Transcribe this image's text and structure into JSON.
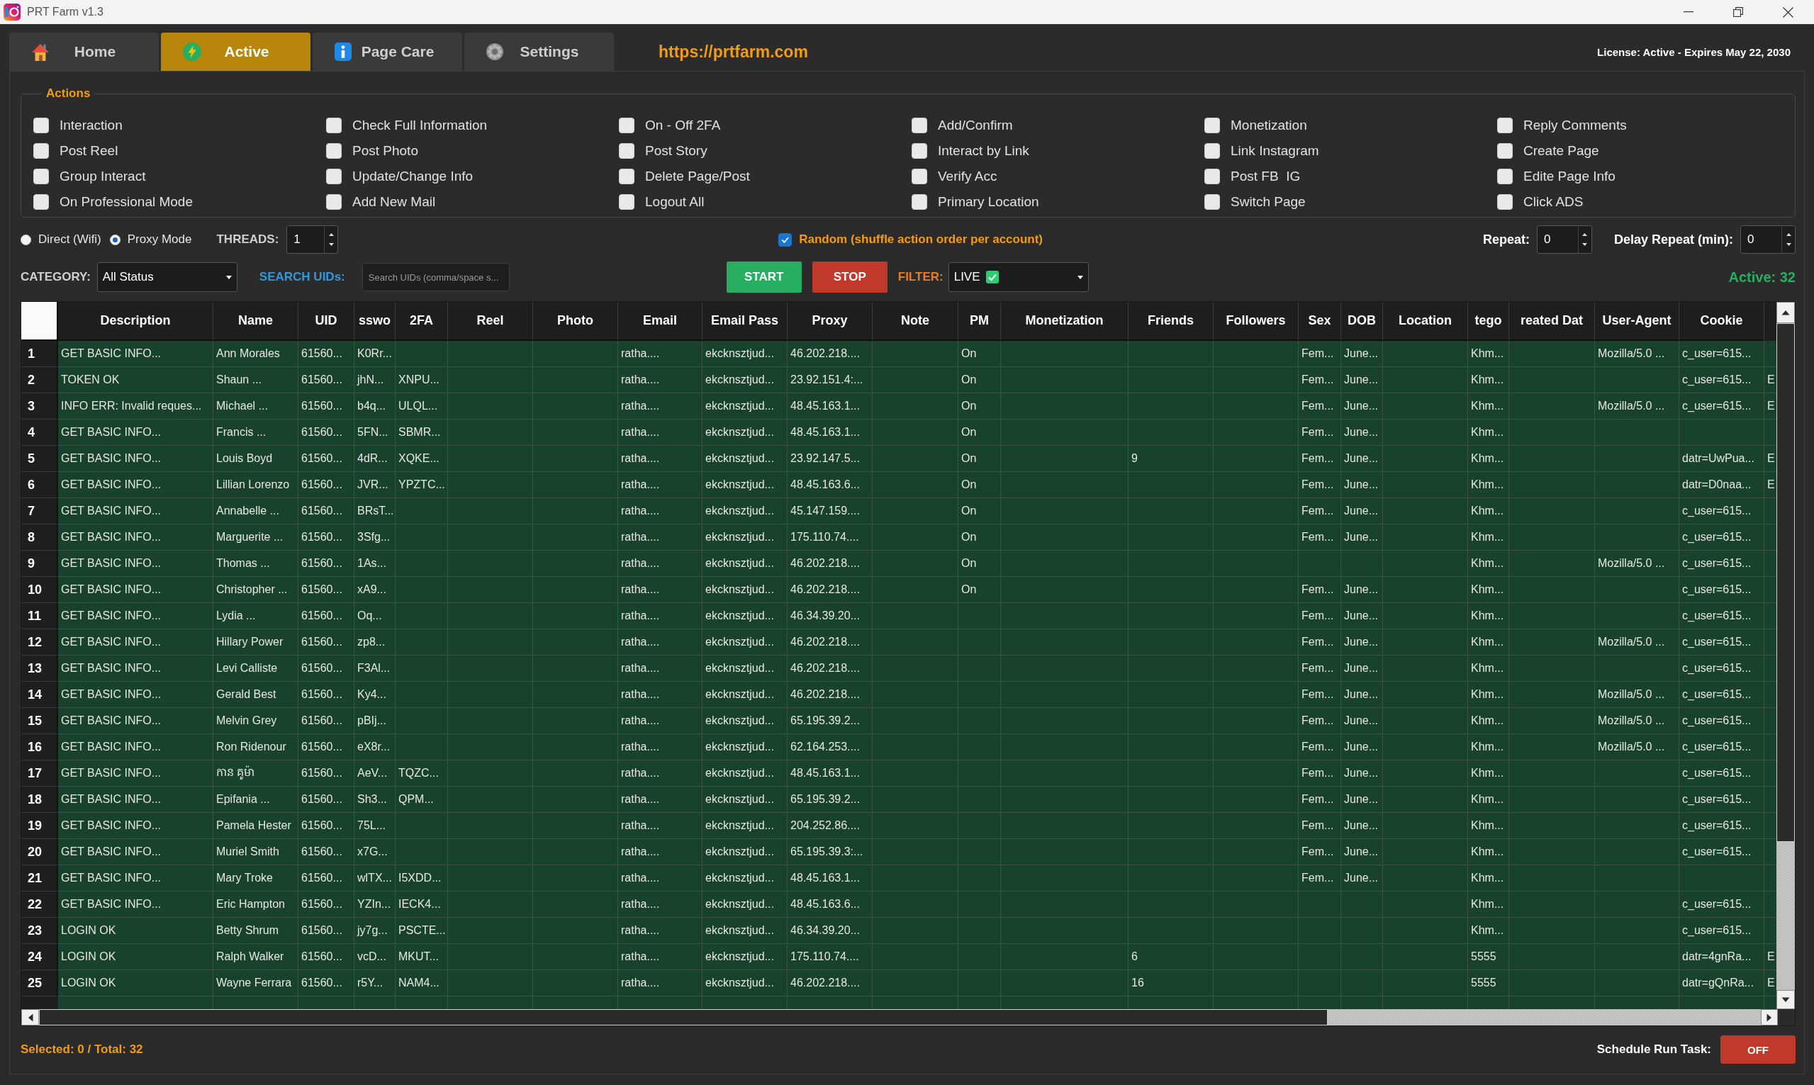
{
  "window": {
    "title": "PRT Farm v1.3"
  },
  "tabs": [
    {
      "label": "Home",
      "selected": false
    },
    {
      "label": "Active",
      "selected": true
    },
    {
      "label": "Page Care",
      "selected": false
    },
    {
      "label": "Settings",
      "selected": false
    }
  ],
  "website_link": "https://prtfarm.com",
  "license": "License: Active - Expires May 22, 2030",
  "actions": {
    "title": "Actions",
    "options": [
      {
        "label": "Interaction",
        "checked": false
      },
      {
        "label": "Check Full Information",
        "checked": false
      },
      {
        "label": "On - Off 2FA",
        "checked": false
      },
      {
        "label": "Add/Confirm",
        "checked": false
      },
      {
        "label": "Monetization",
        "checked": false
      },
      {
        "label": "Reply Comments",
        "checked": false
      },
      {
        "label": "Post Reel",
        "checked": false
      },
      {
        "label": "Post Photo",
        "checked": false
      },
      {
        "label": "Post Story",
        "checked": false
      },
      {
        "label": "Interact by Link",
        "checked": false
      },
      {
        "label": "Link Instagram",
        "checked": false
      },
      {
        "label": "Create Page",
        "checked": false
      },
      {
        "label": "Group Interact",
        "checked": false
      },
      {
        "label": "Update/Change Info",
        "checked": false
      },
      {
        "label": "Delete Page/Post",
        "checked": false
      },
      {
        "label": "Verify Acc",
        "checked": false
      },
      {
        "label": "Post FB  IG",
        "checked": false
      },
      {
        "label": "Edite Page Info",
        "checked": false
      },
      {
        "label": "On Professional Mode",
        "checked": false
      },
      {
        "label": "Add New Mail",
        "checked": false
      },
      {
        "label": "Logout All",
        "checked": false
      },
      {
        "label": "Primary Location",
        "checked": false
      },
      {
        "label": "Switch Page",
        "checked": false
      },
      {
        "label": "Click ADS",
        "checked": false
      }
    ]
  },
  "connection": {
    "options": [
      {
        "label": "Direct (Wifi)",
        "selected": false
      },
      {
        "label": "Proxy Mode",
        "selected": true
      }
    ]
  },
  "threads": {
    "label": "THREADS:",
    "value": "1"
  },
  "random_order": {
    "label": "Random (shuffle action order per account)",
    "checked": true
  },
  "repeat": {
    "label": "Repeat:",
    "value": "0"
  },
  "delay_repeat": {
    "label": "Delay Repeat (min):",
    "value": "0"
  },
  "category": {
    "label": "CATEGORY:",
    "value": "All Status"
  },
  "search_uids": {
    "label": "SEARCH UIDs:",
    "placeholder": "Search UIDs (comma/space s..."
  },
  "buttons": [
    {
      "label": "START",
      "kind": "start"
    },
    {
      "label": "STOP",
      "kind": "stop"
    }
  ],
  "filter": {
    "label": "FILTER:",
    "value": "LIVE"
  },
  "active_count": "Active: 32",
  "table": {
    "columns": [
      "Description",
      "Name",
      "UID",
      "sswo",
      "2FA",
      "Reel",
      "Photo",
      "Email",
      "Email Pass",
      "Proxy",
      "Note",
      "PM",
      "Monetization",
      "Friends",
      "Followers",
      "Sex",
      "DOB",
      "Location",
      "tego",
      "reated Dat",
      "User-Agent",
      "Cookie"
    ],
    "rows": [
      {
        "number": "1",
        "description": "GET BASIC INFO...",
        "name": "Ann Morales",
        "uid": "61560...",
        "column_4": "K0Rr...",
        "email": "ratha....",
        "email_pass": "ekcknsztjud...",
        "proxy": "46.202.218....",
        "pm": "On",
        "sex": "Fem...",
        "dob": "June...",
        "column_19": "Khm...",
        "user_agent": "Mozilla/5.0 ...",
        "cookie": "c_user=615..."
      },
      {
        "number": "2",
        "description": "TOKEN OK",
        "name": "Shaun ...",
        "uid": "61560...",
        "column_4": "jhN...",
        "two_fa": "XNPU...",
        "email": "ratha....",
        "email_pass": "ekcknsztjud...",
        "proxy": "23.92.151.4:...",
        "pm": "On",
        "sex": "Fem...",
        "dob": "June...",
        "column_19": "Khm...",
        "cookie": "c_user=615...",
        "column_23": "E"
      },
      {
        "number": "3",
        "description": "INFO ERR: Invalid reques...",
        "name": "Michael ...",
        "uid": "61560...",
        "column_4": "b4q...",
        "two_fa": "ULQL...",
        "email": "ratha....",
        "email_pass": "ekcknsztjud...",
        "proxy": "48.45.163.1...",
        "pm": "On",
        "sex": "Fem...",
        "dob": "June...",
        "column_19": "Khm...",
        "user_agent": "Mozilla/5.0 ...",
        "cookie": "c_user=615...",
        "column_23": "E"
      },
      {
        "number": "4",
        "description": "GET BASIC INFO...",
        "name": "Francis ...",
        "uid": "61560...",
        "column_4": "5FN...",
        "two_fa": "SBMR...",
        "email": "ratha....",
        "email_pass": "ekcknsztjud...",
        "proxy": "48.45.163.1...",
        "pm": "On",
        "sex": "Fem...",
        "dob": "June...",
        "column_19": "Khm..."
      },
      {
        "number": "5",
        "description": "GET BASIC INFO...",
        "name": "Louis Boyd",
        "uid": "61560...",
        "column_4": "4dR...",
        "two_fa": "XQKE...",
        "email": "ratha....",
        "email_pass": "ekcknsztjud...",
        "proxy": "23.92.147.5...",
        "pm": "On",
        "friends": "9",
        "sex": "Fem...",
        "dob": "June...",
        "column_19": "Khm...",
        "cookie": "datr=UwPua...",
        "column_23": "E"
      },
      {
        "number": "6",
        "description": "GET BASIC INFO...",
        "name": "Lillian Lorenzo",
        "uid": "61560...",
        "column_4": "JVR...",
        "two_fa": "YPZTC...",
        "email": "ratha....",
        "email_pass": "ekcknsztjud...",
        "proxy": "48.45.163.6...",
        "pm": "On",
        "sex": "Fem...",
        "dob": "June...",
        "column_19": "Khm...",
        "cookie": "datr=D0naa...",
        "column_23": "E"
      },
      {
        "number": "7",
        "description": "GET BASIC INFO...",
        "name": "Annabelle ...",
        "uid": "61560...",
        "column_4": "BRsT...",
        "email": "ratha....",
        "email_pass": "ekcknsztjud...",
        "proxy": "45.147.159....",
        "pm": "On",
        "sex": "Fem...",
        "dob": "June...",
        "column_19": "Khm...",
        "cookie": "c_user=615..."
      },
      {
        "number": "8",
        "description": "GET BASIC INFO...",
        "name": "Marguerite ...",
        "uid": "61560...",
        "column_4": "3Sfg...",
        "email": "ratha....",
        "email_pass": "ekcknsztjud...",
        "proxy": "175.110.74....",
        "pm": "On",
        "sex": "Fem...",
        "dob": "June...",
        "column_19": "Khm...",
        "cookie": "c_user=615..."
      },
      {
        "number": "9",
        "description": "GET BASIC INFO...",
        "name": "Thomas ...",
        "uid": "61560...",
        "column_4": "1As...",
        "email": "ratha....",
        "email_pass": "ekcknsztjud...",
        "proxy": "46.202.218....",
        "pm": "On",
        "column_19": "Khm...",
        "user_agent": "Mozilla/5.0 ...",
        "cookie": "c_user=615..."
      },
      {
        "number": "10",
        "description": "GET BASIC INFO...",
        "name": "Christopher ...",
        "uid": "61560...",
        "column_4": "xA9...",
        "email": "ratha....",
        "email_pass": "ekcknsztjud...",
        "proxy": "46.202.218....",
        "pm": "On",
        "sex": "Fem...",
        "dob": "June...",
        "column_19": "Khm...",
        "cookie": "c_user=615..."
      },
      {
        "number": "11",
        "description": "GET BASIC INFO...",
        "name": "Lydia ...",
        "uid": "61560...",
        "column_4": "Oq...",
        "email": "ratha....",
        "email_pass": "ekcknsztjud...",
        "proxy": "46.34.39.20...",
        "sex": "Fem...",
        "dob": "June...",
        "column_19": "Khm...",
        "cookie": "c_user=615..."
      },
      {
        "number": "12",
        "description": "GET BASIC INFO...",
        "name": "Hillary Power",
        "uid": "61560...",
        "column_4": "zp8...",
        "email": "ratha....",
        "email_pass": "ekcknsztjud...",
        "proxy": "46.202.218....",
        "sex": "Fem...",
        "dob": "June...",
        "column_19": "Khm...",
        "user_agent": "Mozilla/5.0 ...",
        "cookie": "c_user=615..."
      },
      {
        "number": "13",
        "description": "GET BASIC INFO...",
        "name": "Levi Calliste",
        "uid": "61560...",
        "column_4": "F3Al...",
        "email": "ratha....",
        "email_pass": "ekcknsztjud...",
        "proxy": "46.202.218....",
        "sex": "Fem...",
        "dob": "June...",
        "column_19": "Khm...",
        "cookie": "c_user=615..."
      },
      {
        "number": "14",
        "description": "GET BASIC INFO...",
        "name": "Gerald Best",
        "uid": "61560...",
        "column_4": "Ky4...",
        "email": "ratha....",
        "email_pass": "ekcknsztjud...",
        "proxy": "46.202.218....",
        "sex": "Fem...",
        "dob": "June...",
        "column_19": "Khm...",
        "user_agent": "Mozilla/5.0 ...",
        "cookie": "c_user=615..."
      },
      {
        "number": "15",
        "description": "GET BASIC INFO...",
        "name": "Melvin Grey",
        "uid": "61560...",
        "column_4": "pBIj...",
        "email": "ratha....",
        "email_pass": "ekcknsztjud...",
        "proxy": "65.195.39.2...",
        "sex": "Fem...",
        "dob": "June...",
        "column_19": "Khm...",
        "user_agent": "Mozilla/5.0 ...",
        "cookie": "c_user=615..."
      },
      {
        "number": "16",
        "description": "GET BASIC INFO...",
        "name": "Ron Ridenour",
        "uid": "61560...",
        "column_4": "eX8r...",
        "email": "ratha....",
        "email_pass": "ekcknsztjud...",
        "proxy": "62.164.253....",
        "sex": "Fem...",
        "dob": "June...",
        "column_19": "Khm...",
        "user_agent": "Mozilla/5.0 ...",
        "cookie": "c_user=615..."
      },
      {
        "number": "17",
        "description": "GET BASIC INFO...",
        "name": "កាន គូម៉ា",
        "uid": "61560...",
        "column_4": "AeV...",
        "two_fa": "TQZC...",
        "email": "ratha....",
        "email_pass": "ekcknsztjud...",
        "proxy": "48.45.163.1...",
        "sex": "Fem...",
        "dob": "June...",
        "column_19": "Khm...",
        "cookie": "c_user=615..."
      },
      {
        "number": "18",
        "description": "GET BASIC INFO...",
        "name": "Epifania ...",
        "uid": "61560...",
        "column_4": "Sh3...",
        "two_fa": "QPM...",
        "email": "ratha....",
        "email_pass": "ekcknsztjud...",
        "proxy": "65.195.39.2...",
        "sex": "Fem...",
        "dob": "June...",
        "column_19": "Khm...",
        "cookie": "c_user=615..."
      },
      {
        "number": "19",
        "description": "GET BASIC INFO...",
        "name": "Pamela Hester",
        "uid": "61560...",
        "column_4": "75L...",
        "email": "ratha....",
        "email_pass": "ekcknsztjud...",
        "proxy": "204.252.86....",
        "sex": "Fem...",
        "dob": "June...",
        "column_19": "Khm...",
        "cookie": "c_user=615..."
      },
      {
        "number": "20",
        "description": "GET BASIC INFO...",
        "name": "Muriel Smith",
        "uid": "61560...",
        "column_4": "x7G...",
        "email": "ratha....",
        "email_pass": "ekcknsztjud...",
        "proxy": "65.195.39.3:...",
        "sex": "Fem...",
        "dob": "June...",
        "column_19": "Khm...",
        "cookie": "c_user=615..."
      },
      {
        "number": "21",
        "description": "GET BASIC INFO...",
        "name": "Mary Troke",
        "uid": "61560...",
        "column_4": "wlTX...",
        "two_fa": "I5XDD...",
        "email": "ratha....",
        "email_pass": "ekcknsztjud...",
        "proxy": "48.45.163.1...",
        "sex": "Fem...",
        "dob": "June...",
        "column_19": "Khm..."
      },
      {
        "number": "22",
        "description": "GET BASIC INFO...",
        "name": "Eric Hampton",
        "uid": "61560...",
        "column_4": "YZIn...",
        "two_fa": "IECK4...",
        "email": "ratha....",
        "email_pass": "ekcknsztjud...",
        "proxy": "48.45.163.6...",
        "column_19": "Khm...",
        "cookie": "c_user=615..."
      },
      {
        "number": "23",
        "description": "LOGIN OK",
        "name": "Betty Shrum",
        "uid": "61560...",
        "column_4": "jy7g...",
        "two_fa": "PSCTE...",
        "email": "ratha....",
        "email_pass": "ekcknsztjud...",
        "proxy": "46.34.39.20...",
        "column_19": "Khm...",
        "cookie": "c_user=615..."
      },
      {
        "number": "24",
        "description": "LOGIN OK",
        "name": "Ralph Walker",
        "uid": "61560...",
        "column_4": "vcD...",
        "two_fa": "MKUT...",
        "email": "ratha....",
        "email_pass": "ekcknsztjud...",
        "proxy": "175.110.74....",
        "friends": "6",
        "column_19": "5555",
        "cookie": "datr=4gnRa...",
        "column_23": "E"
      },
      {
        "number": "25",
        "description": "LOGIN OK",
        "name": "Wayne Ferrara",
        "uid": "61560...",
        "column_4": "r5Y...",
        "two_fa": "NAM4...",
        "email": "ratha....",
        "email_pass": "ekcknsztjud...",
        "proxy": "46.202.218....",
        "friends": "16",
        "column_19": "5555",
        "cookie": "datr=gQnRa...",
        "column_23": "E"
      }
    ]
  },
  "status_bar": {
    "selection": "Selected: 0 / Total: 32",
    "schedule": {
      "label": "Schedule Run Task:",
      "button": "OFF",
      "on": false
    }
  }
}
